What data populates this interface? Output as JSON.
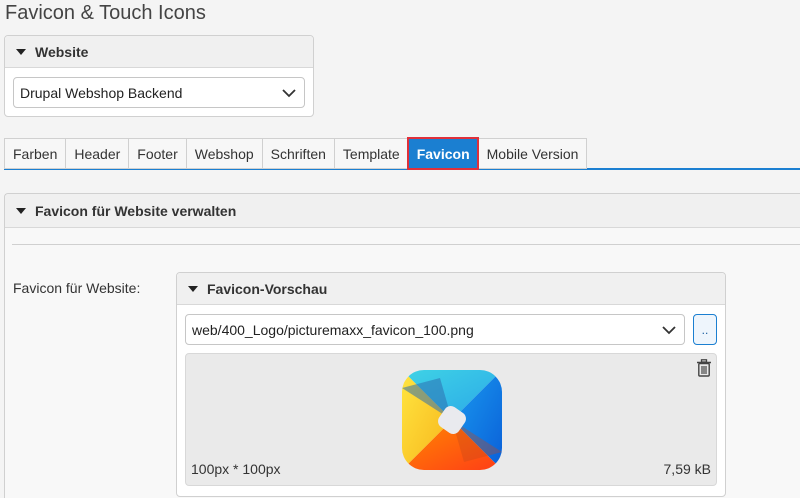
{
  "page": {
    "title": "Favicon & Touch Icons"
  },
  "website": {
    "header": "Website",
    "selected": "Drupal Webshop Backend"
  },
  "tabs": [
    {
      "label": "Farben"
    },
    {
      "label": "Header"
    },
    {
      "label": "Footer"
    },
    {
      "label": "Webshop"
    },
    {
      "label": "Schriften"
    },
    {
      "label": "Template"
    },
    {
      "label": "Favicon",
      "active": true
    },
    {
      "label": "Mobile Version"
    }
  ],
  "panel": {
    "header": "Favicon für Website verwalten",
    "field_label": "Favicon für Website:",
    "preview": {
      "header": "Favicon-Vorschau",
      "file": "web/400_Logo/picturemaxx_favicon_100.png",
      "browse_label": "..",
      "dimensions": "100px * 100px",
      "file_size": "7,59 kB"
    }
  },
  "colors": {
    "accent": "#1b7fd1",
    "active_outline": "#e0303a"
  },
  "icons": [
    "caret-down-icon",
    "chevron-down-icon",
    "trash-icon",
    "favicon-image"
  ]
}
